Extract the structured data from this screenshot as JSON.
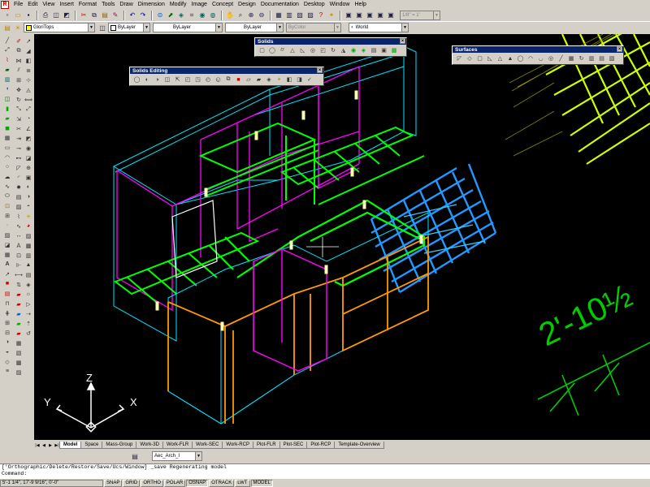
{
  "app": {
    "logo_glyph": "R"
  },
  "menu": [
    "File",
    "Edit",
    "View",
    "Insert",
    "Format",
    "Tools",
    "Draw",
    "Dimension",
    "Modify",
    "Image",
    "Concept",
    "Design",
    "Documentation",
    "Desktop",
    "Window",
    "Help"
  ],
  "toolbar1": {
    "icons": [
      "new-icon",
      "open-icon",
      "save-icon",
      "print-icon",
      "print-preview-icon",
      "cut-icon",
      "copy-icon",
      "paste-icon",
      "match-properties-icon",
      "undo-icon",
      "redo-icon",
      "hyperlink-icon",
      "track-icon",
      "pan-icon",
      "zoom-realtime-icon",
      "zoom-window-icon",
      "zoom-previous-icon",
      "properties-icon",
      "design-center-icon",
      "tool-palettes-icon",
      "help-icon"
    ],
    "scale_combo": "1/8\" = 1'"
  },
  "toolbar2": {
    "layer": "GloriTops",
    "color": "ByLayer",
    "linetype": "ByLayer",
    "lineweight": "ByLayer",
    "plotstyle": "ByColor",
    "ucs": "World"
  },
  "palettes": {
    "solids": {
      "title": "Solids"
    },
    "solids_editing": {
      "title": "Solids Editing"
    },
    "surfaces": {
      "title": "Surfaces"
    }
  },
  "canvas": {
    "axis_x": "X",
    "axis_y": "Y",
    "axis_z": "Z",
    "dimension_text": "2'-10½"
  },
  "tabs": [
    "Model",
    "Space",
    "Mass-Group",
    "Work-3D",
    "Work-FLR",
    "Work-SEC",
    "Work-RCP",
    "Plot-FLR",
    "Plot-SEC",
    "Plot-RCP",
    "Template-Overview"
  ],
  "active_tab": "Model",
  "sub_combo": "Aec_Arch_I",
  "command": {
    "history": "['Orthographic/Delete/Restore/Save/Ucs/Window] _save Regenerating model",
    "prompt": "Command:"
  },
  "status": {
    "coords": "5'-1 1/4\", 17'-9 9/16\", 0'-0\"",
    "toggles": [
      "SNAP",
      "GRID",
      "ORTHO",
      "POLAR",
      "OSNAP",
      "OTRACK",
      "LWT",
      "MODEL"
    ]
  },
  "colors": {
    "canvas_bg": "#000000",
    "cyan_wire": "#00e5ff",
    "magenta_wire": "#ff00ff",
    "green_wire": "#00ff00",
    "orange_wire": "#ff9900",
    "blue_mesh": "#2299ff",
    "yellow_mesh": "#ccff00",
    "dim_green": "#00cc00"
  }
}
